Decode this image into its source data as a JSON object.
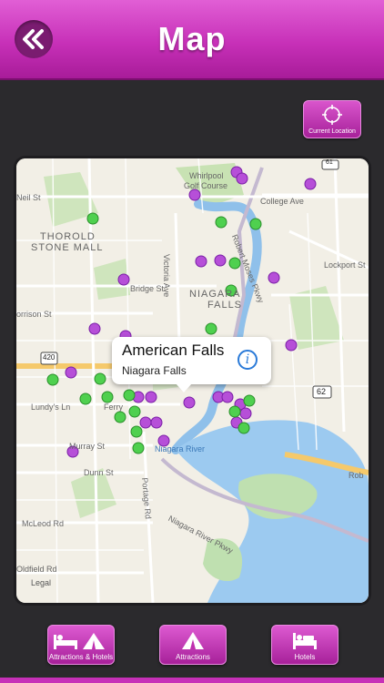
{
  "header": {
    "title": "Map",
    "back_icon": "double-chevron-left-icon",
    "bg_color": "#c730b8"
  },
  "current_location": {
    "label": "Current Location",
    "icon": "crosshair-icon"
  },
  "map": {
    "labels": {
      "whirlpool": "Whirlpool",
      "golf_course": "Golf Course",
      "college_ave": "College Ave",
      "neil_st": "Neil St",
      "thorold": "THOROLD",
      "stone_mall": "STONE MALL",
      "victoria_ave": "Victoria Ave",
      "robert_moses": "Robert Moses Pkwy",
      "lockport_st": "Lockport St",
      "bridge_st": "Bridge St",
      "niagara": "NIAGARA",
      "falls": "FALLS",
      "orrison_st": "orrison St",
      "lundys_ln": "Lundy's Ln",
      "ferry": "Ferry",
      "murray_st": "Murray St",
      "dunn_st": "Dunn St",
      "niagara_river": "Niagara River",
      "portage_rd": "Portage Rd",
      "mcleod_rd": "McLeod Rd",
      "niagara_river_pkwy": "Niagara River Pkwy",
      "oldfield_rd": "Oldfield Rd",
      "rob": "Rob",
      "route_420": "420",
      "route_62": "62",
      "route_61": "61"
    },
    "legal": "Legal",
    "callout": {
      "title": "American Falls",
      "subtitle": "Niagara Falls",
      "icon": "info-icon"
    },
    "pin_colors": {
      "attraction": "#b64fd8",
      "hotel": "#4fd04f"
    }
  },
  "footer": {
    "tabs": [
      {
        "label": "Attractions & Hotels",
        "icon": "bed-and-tent-icon"
      },
      {
        "label": "Attractions",
        "icon": "tent-icon"
      },
      {
        "label": "Hotels",
        "icon": "bed-icon"
      }
    ]
  }
}
